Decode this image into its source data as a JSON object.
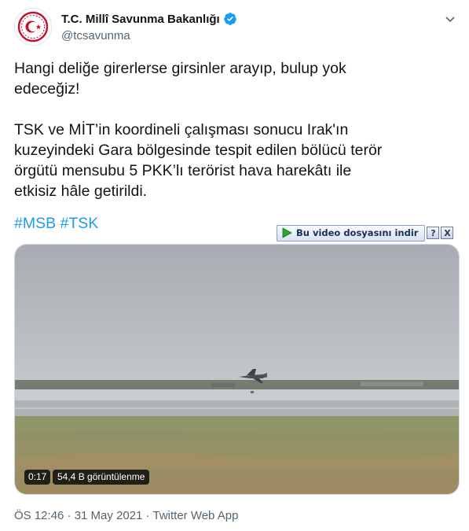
{
  "account": {
    "display_name": "T.C. Millî Savunma Bakanlığı",
    "handle": "@tcsavunma",
    "avatar_icon": "turkish-armed-forces-emblem",
    "verified_icon": "verified-badge-icon",
    "brand_color": "#c8102e",
    "verified_color": "#1d9bf0"
  },
  "tweet": {
    "line1": "Hangi deliğe girerlerse girsinler arayıp, bulup yok",
    "line2": "edeceğiz!",
    "line3": "TSK ve MİT’in koordineli çalışması sonucu Irak'ın",
    "line4": "kuzeyindeki Gara bölgesinde tespit edilen bölücü terör",
    "line5": "örgütü mensubu 5 PKK’lı terörist hava harekâtı ile",
    "line6": "etkisiz hâle getirildi.",
    "hashtags": [
      "#MSB",
      "#TSK"
    ],
    "link_color": "#1d9bf0"
  },
  "download_bar": {
    "label": "Bu video dosyasını indir",
    "help_label": "?",
    "close_label": "X",
    "play_icon": "green-play-icon"
  },
  "video": {
    "time": "0:17",
    "views": "54,4 B görüntülenme"
  },
  "meta": {
    "timestamp": "ÖS 12:46 · 31 May 2021 · Twitter Web App"
  }
}
